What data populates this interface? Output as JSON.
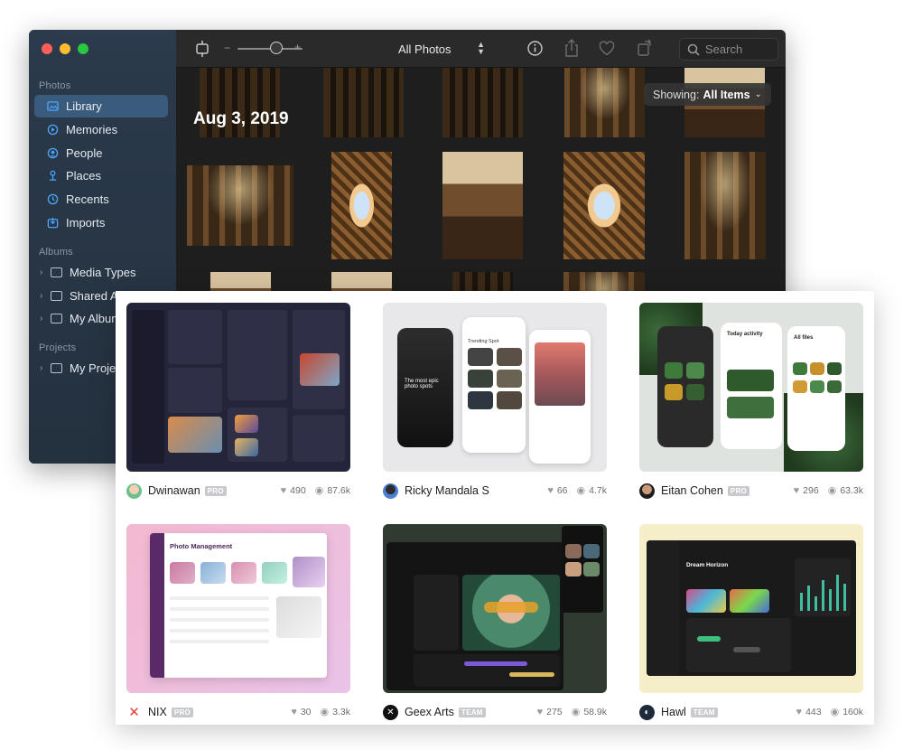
{
  "photos_app": {
    "sidebar": {
      "sections": [
        {
          "title": "Photos",
          "items": [
            {
              "label": "Library",
              "icon": "library-icon",
              "active": true
            },
            {
              "label": "Memories",
              "icon": "memories-icon"
            },
            {
              "label": "People",
              "icon": "people-icon"
            },
            {
              "label": "Places",
              "icon": "places-icon"
            },
            {
              "label": "Recents",
              "icon": "recents-icon"
            },
            {
              "label": "Imports",
              "icon": "imports-icon"
            }
          ]
        },
        {
          "title": "Albums",
          "items": [
            {
              "label": "Media Types",
              "icon": "folder-icon"
            },
            {
              "label": "Shared Albums",
              "icon": "folder-icon"
            },
            {
              "label": "My Albums",
              "icon": "folder-icon"
            }
          ]
        },
        {
          "title": "Projects",
          "items": [
            {
              "label": "My Projects",
              "icon": "folder-icon"
            }
          ]
        }
      ]
    },
    "toolbar": {
      "zoom_minus": "−",
      "zoom_plus": "+",
      "view_select": "All Photos",
      "search_placeholder": "Search"
    },
    "content": {
      "date_title": "Aug 3, 2019",
      "showing_label": "Showing:",
      "showing_value": "All Items"
    }
  },
  "shots": [
    {
      "author": "Dwinawan",
      "badge": "PRO",
      "likes": "490",
      "views": "87.6k"
    },
    {
      "author": "Ricky Mandala S",
      "badge": "",
      "likes": "66",
      "views": "4.7k"
    },
    {
      "author": "Eitan Cohen",
      "badge": "PRO",
      "likes": "296",
      "views": "63.3k"
    },
    {
      "author": "NIX",
      "badge": "PRO",
      "likes": "30",
      "views": "3.3k"
    },
    {
      "author": "Geex Arts",
      "badge": "TEAM",
      "likes": "275",
      "views": "58.9k"
    },
    {
      "author": "Hawl",
      "badge": "TEAM",
      "likes": "443",
      "views": "160k"
    }
  ],
  "shot_texts": {
    "photo_management": "Photo Management",
    "today_activity": "Today activity",
    "all_files": "All files",
    "dream_horizon": "Dream Horizon",
    "trending_spot": "Trending Spot",
    "most_epic": "The most epic photo spots"
  },
  "colors": {
    "sidebar_bg": "#2b3a4c",
    "sidebar_active": "#3b5b7d",
    "accent_blue": "#4aa6ff",
    "window_bg": "#1e1e1e",
    "badge_gray": "#c7c9cc"
  }
}
